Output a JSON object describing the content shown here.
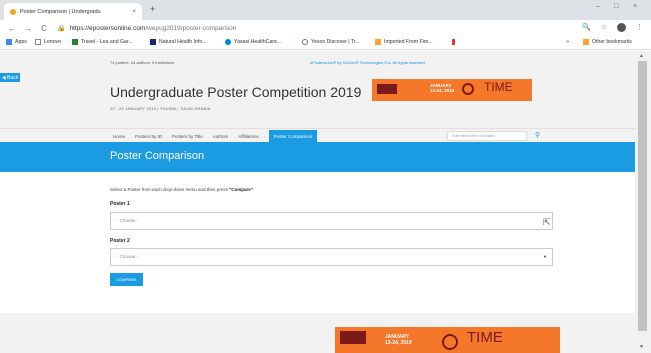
{
  "browser": {
    "tab_title": "Poster Comparison | Undergradu",
    "tab_close": "×",
    "new_tab": "+",
    "url_host": "https://epostersonline.com",
    "url_path": "/wepug2019/poster-comparison",
    "window_controls": [
      "–",
      "□",
      "×"
    ],
    "nav": {
      "back": "←",
      "forward": "→",
      "reload": "C",
      "home": "⌂"
    },
    "bookmarks": [
      {
        "label": "Apps",
        "color": "#4285f4"
      },
      {
        "label": "Lenovo",
        "color": "#888888"
      },
      {
        "label": "Travel - Lea and Gar...",
        "color": "#2e7d32"
      },
      {
        "label": "Natural Health Info...",
        "color": "#1a237e"
      },
      {
        "label": "Yasasi HealthCare...",
        "color": "#0288d1"
      },
      {
        "label": "Yesoo Discover | Tr...",
        "color": "#607d8b"
      },
      {
        "label": "Imported From Fire...",
        "color": "#f9a825"
      },
      {
        "label": "Other bookmarks",
        "color": "#f9a825"
      }
    ],
    "more_bookmarks": "»"
  },
  "topstrip": {
    "left": "74 posters, 94 authors, 9 institutions",
    "credit_link": "ePostersLive®",
    "credit_rest": " by SciGen® Technologies S.A. All rights reserved."
  },
  "header": {
    "back_label": "Back",
    "title": "Undergraduate Poster Competition 2019",
    "subtitle": "20 - 24 JANUARY 2019 | THUWAL, SAUDI ARABIA",
    "banner_date_1": "JANUARY",
    "banner_date_2": "13-24, 2019",
    "banner_word": "TIME"
  },
  "nav": {
    "items": [
      "Home",
      "Posters by ID",
      "Posters by Title",
      "Authors",
      "Affiliations",
      "Poster Comparison"
    ],
    "search_placeholder": "Enter terms then hit Search..."
  },
  "section_title": "Poster Comparison",
  "form": {
    "intro_text": "Select a Poster from each drop-down menu and then press ",
    "intro_bold": "\"Compare\"",
    "poster1_label": "Poster 1",
    "poster1_value": "- Choose -",
    "poster2_label": "Poster 2",
    "poster2_value": "- Choose -",
    "compare_label": "COMPARE"
  },
  "footer": {
    "banner_date_1": "JANUARY",
    "banner_date_2": "13-24, 2019",
    "banner_word": "TIME"
  },
  "colors": {
    "accent": "#1a9be2",
    "banner": "#f5782a"
  }
}
